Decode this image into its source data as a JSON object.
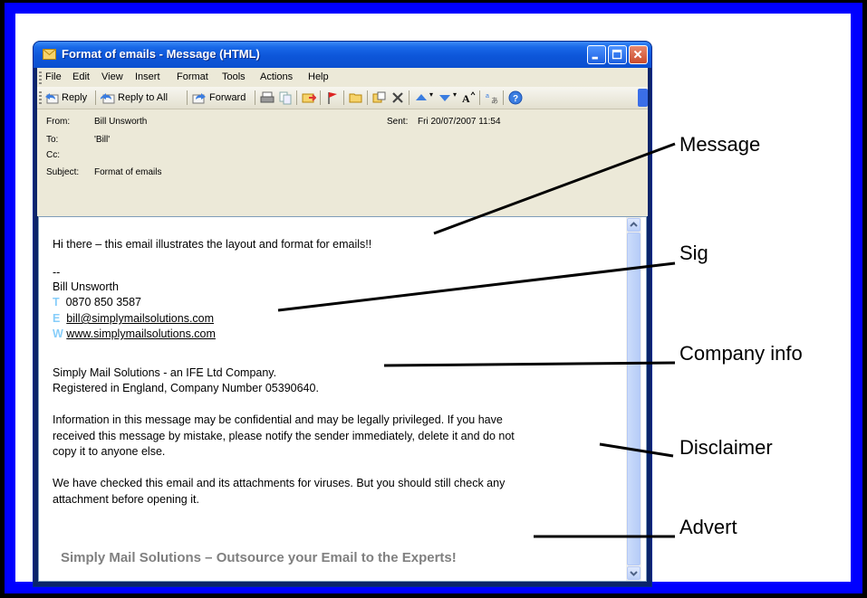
{
  "window": {
    "title": "Format of emails - Message (HTML)"
  },
  "menu": [
    "File",
    "Edit",
    "View",
    "Insert",
    "Format",
    "Tools",
    "Actions",
    "Help"
  ],
  "toolbar": {
    "reply": "Reply",
    "reply_all": "Reply to All",
    "forward": "Forward"
  },
  "header": {
    "from_label": "From:",
    "from_value": "Bill Unsworth",
    "to_label": "To:",
    "to_value": "'Bill'",
    "cc_label": "Cc:",
    "cc_value": "",
    "subject_label": "Subject:",
    "subject_value": "Format of emails",
    "sent_label": "Sent:",
    "sent_value": "Fri 20/07/2007 11:54"
  },
  "body": {
    "greeting": "Hi there – this email illustrates the layout and format for emails!!",
    "sig_dash": "--",
    "sig_name": "Bill Unsworth",
    "sig_t_letter": "T",
    "sig_phone": "0870 850 3587",
    "sig_e_letter": "E",
    "sig_email": "bill@simplymailsolutions.com",
    "sig_w_letter": "W",
    "sig_web": "www.simplymailsolutions.com",
    "company_line1": "Simply Mail Solutions - an IFE Ltd Company.",
    "company_line2": "Registered in England, Company Number 05390640.",
    "disclaimer_line1": "Information in this message may be confidential and may be legally privileged. If you have",
    "disclaimer_line2": "received this message by mistake, please notify the sender immediately, delete it and do not",
    "disclaimer_line3": "copy it to anyone else.",
    "virus_line1": "We have checked this email and its attachments for viruses. But you should still check any",
    "virus_line2": "attachment before opening it.",
    "advert": "Simply Mail Solutions – Outsource your Email to the Experts!"
  },
  "annotations": {
    "message": "Message",
    "sig": "Sig",
    "company": "Company info",
    "disclaimer": "Disclaimer",
    "advert": "Advert"
  },
  "colors": {
    "background": "#0000ff",
    "title_bar": "#0d56d9",
    "chrome": "#ece9d8",
    "sig_letters": "#87cefa",
    "advert_text": "#808080"
  }
}
